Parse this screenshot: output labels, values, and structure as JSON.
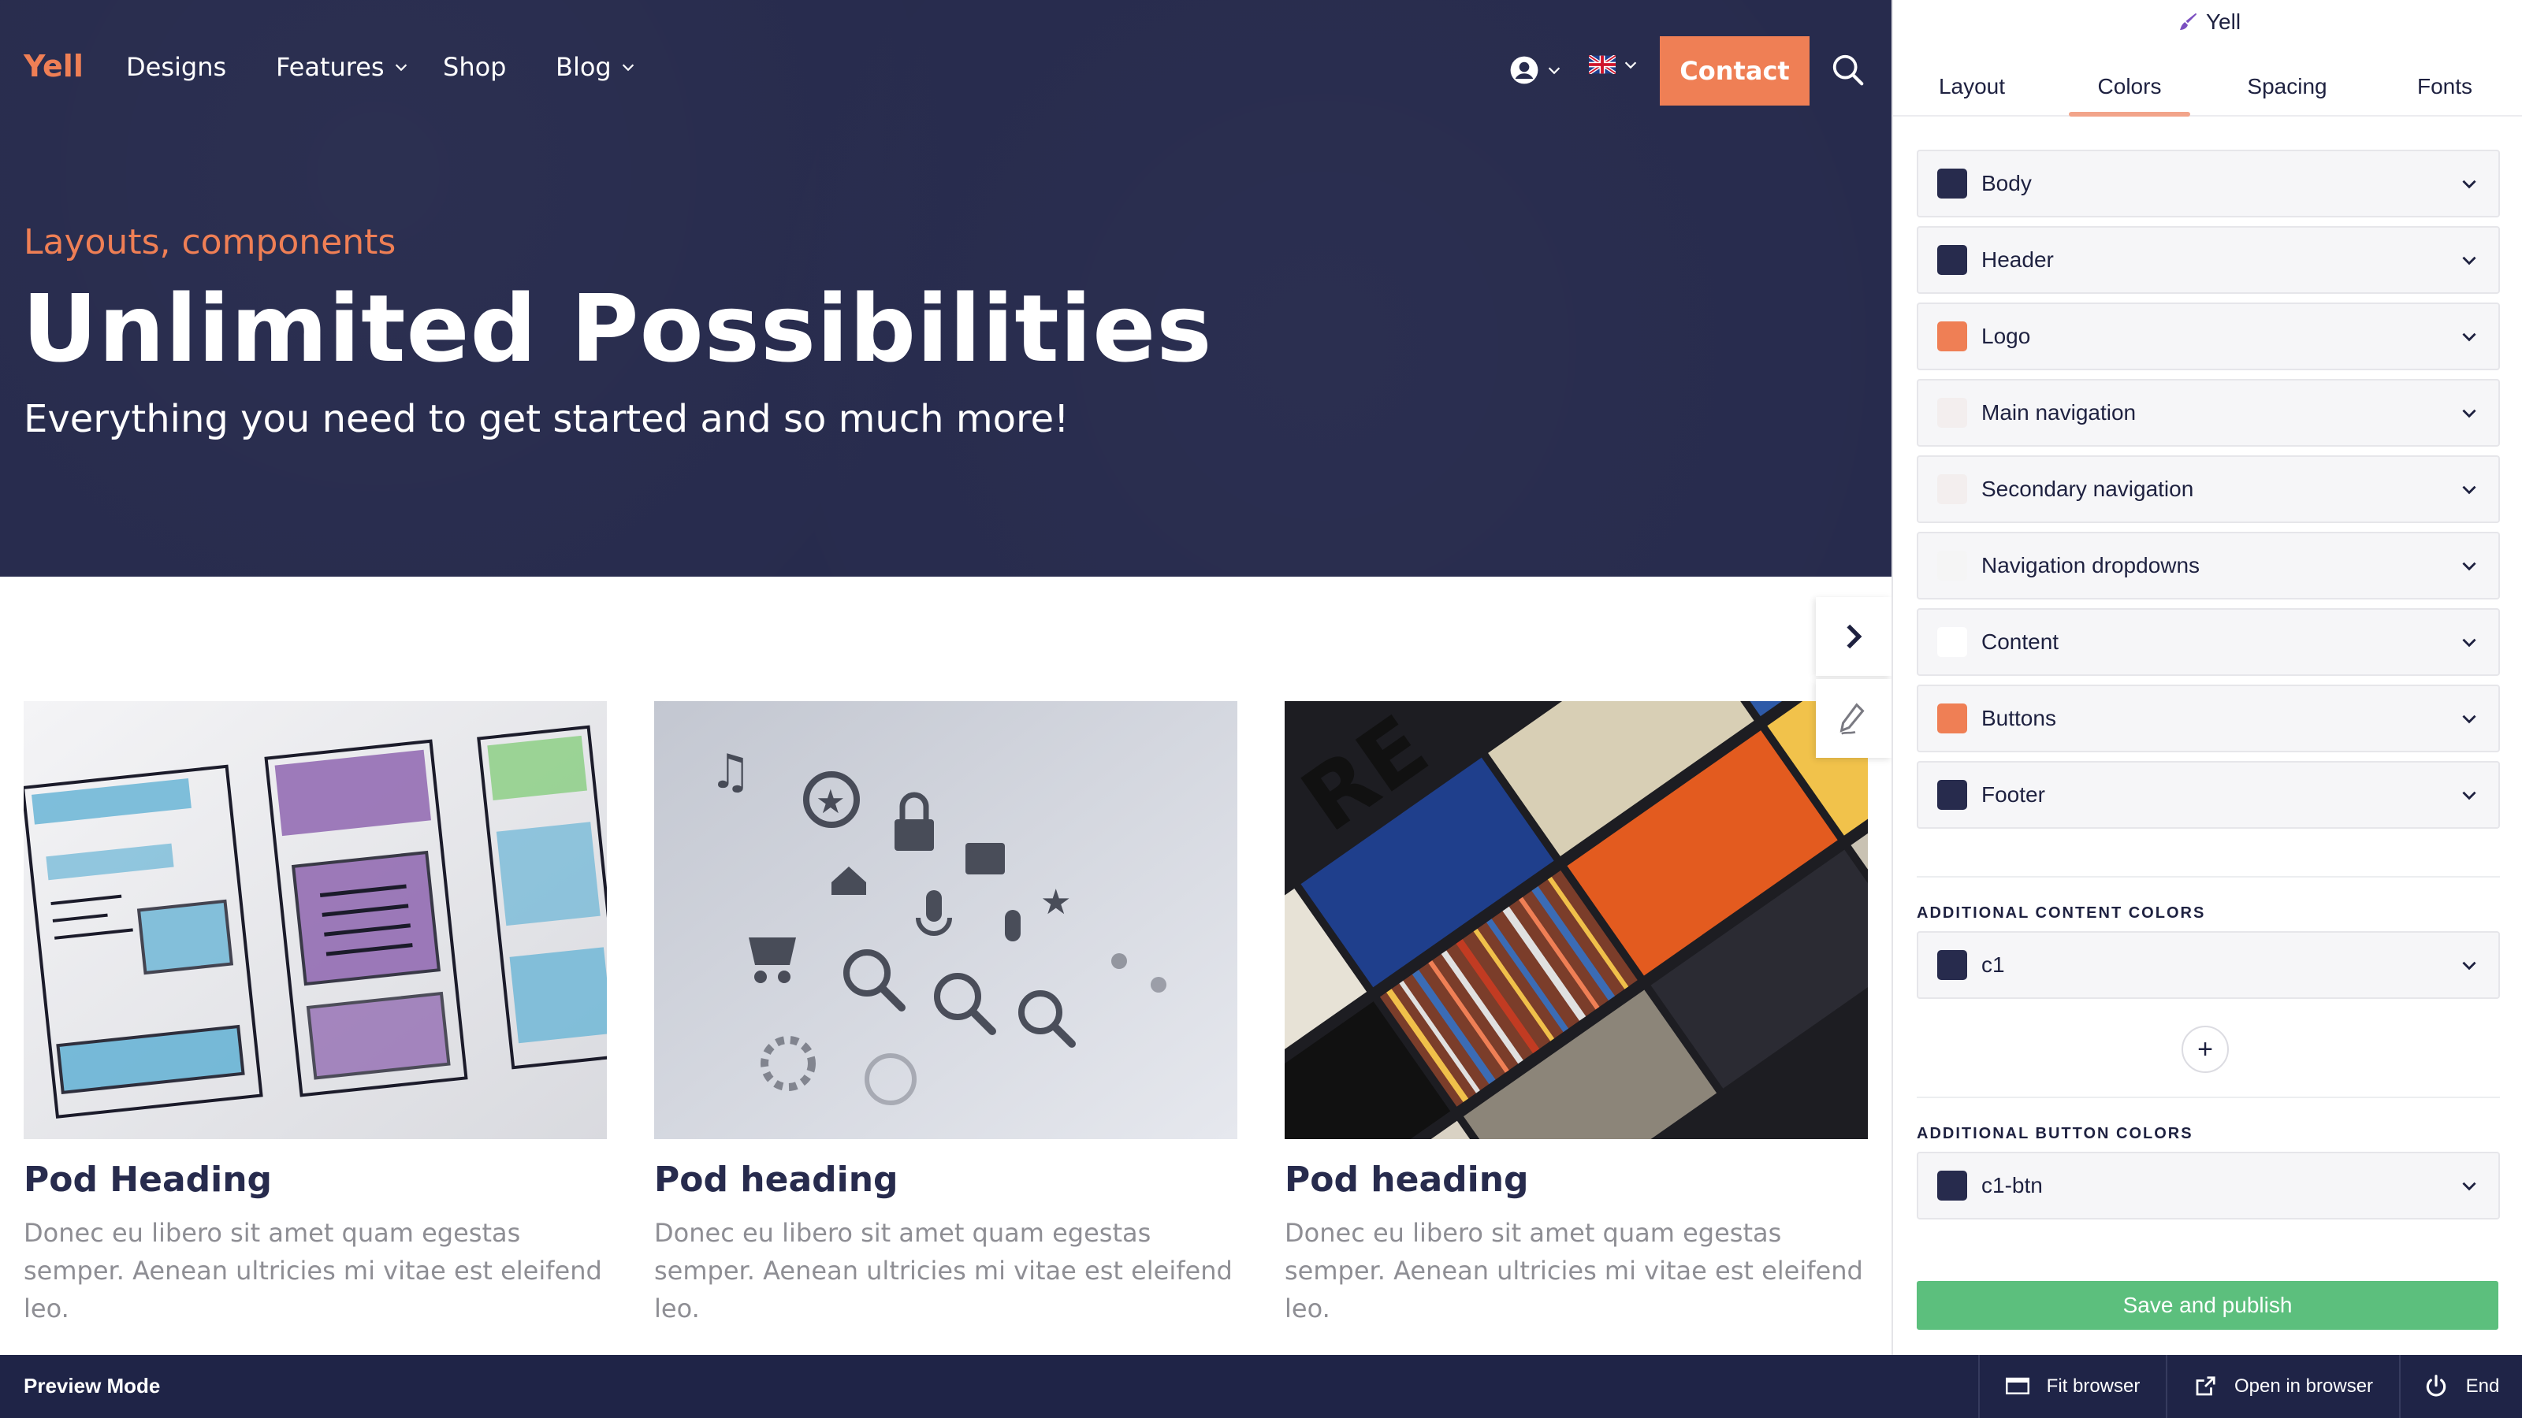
{
  "site": {
    "logo": "Yell",
    "nav": {
      "designs": "Designs",
      "features": "Features",
      "shop": "Shop",
      "blog": "Blog",
      "contact": "Contact"
    },
    "hero": {
      "kicker": "Layouts, components",
      "title": "Unlimited Possibilities",
      "subtitle": "Everything you need to get started and so much more!"
    },
    "pods": [
      {
        "heading": "Pod Heading",
        "text": "Donec eu libero sit amet quam egestas semper. Aenean ultricies mi vitae est eleifend leo."
      },
      {
        "heading": "Pod heading",
        "text": "Donec eu libero sit amet quam egestas semper. Aenean ultricies mi vitae est eleifend leo."
      },
      {
        "heading": "Pod heading",
        "text": "Donec eu libero sit amet quam egestas semper. Aenean ultricies mi vitae est eleifend leo."
      }
    ]
  },
  "panel": {
    "title": "Yell",
    "tabs": [
      "Layout",
      "Colors",
      "Spacing",
      "Fonts"
    ],
    "active_tab": "Colors",
    "colors": [
      {
        "label": "Body",
        "color": "#272b4d"
      },
      {
        "label": "Header",
        "color": "#272b4d"
      },
      {
        "label": "Logo",
        "color": "#ef7f55"
      },
      {
        "label": "Main navigation",
        "color": "#f3eeee"
      },
      {
        "label": "Secondary navigation",
        "color": "#f3eeee"
      },
      {
        "label": "Navigation dropdowns",
        "color": "#f5f5f5"
      },
      {
        "label": "Content",
        "color": "#ffffff"
      },
      {
        "label": "Buttons",
        "color": "#ef7f55"
      },
      {
        "label": "Footer",
        "color": "#272b4d"
      }
    ],
    "additional_content_label": "ADDITIONAL CONTENT COLORS",
    "additional_content": [
      {
        "label": "c1",
        "color": "#272b4d"
      }
    ],
    "additional_button_label": "ADDITIONAL BUTTON COLORS",
    "additional_buttons": [
      {
        "label": "c1-btn",
        "color": "#272b4d"
      }
    ],
    "add_symbol": "+",
    "save": "Save and publish"
  },
  "bottombar": {
    "mode": "Preview Mode",
    "fit": "Fit browser",
    "open": "Open in browser",
    "end": "End"
  },
  "theme": {
    "navy": "#272b4d",
    "orange": "#ef7f55",
    "green": "#5cbf7d"
  }
}
